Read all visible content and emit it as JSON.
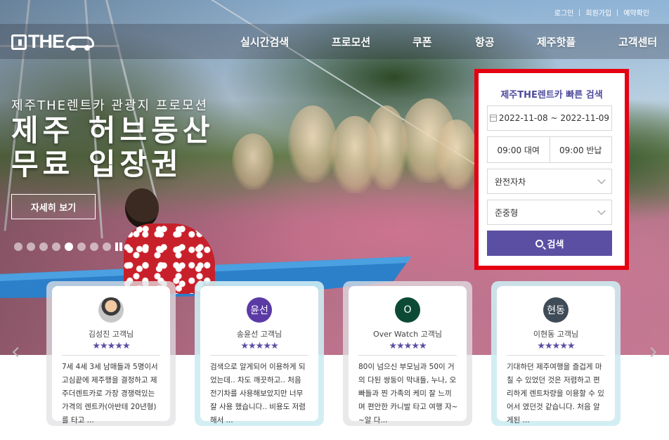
{
  "top_links": [
    "로그인",
    "회원가입",
    "예약확인"
  ],
  "logo": {
    "text": "THE"
  },
  "nav": [
    "실시간검색",
    "프로모션",
    "쿠폰",
    "항공",
    "제주핫플",
    "고객센터"
  ],
  "promo": {
    "subtitle": "제주THE렌트카 관광지 프로모션",
    "title": "제주 허브동산\n무료 입장권",
    "detail_label": "자세히 보기",
    "slide_count": 8,
    "active_slide": 5
  },
  "search": {
    "title": "제주THE렌트카 빠른 검색",
    "date_range": "2022-11-08 ~ 2022-11-09",
    "pickup": "09:00 대여",
    "return": "09:00 반납",
    "insurance": "완전자차",
    "car_class": "준중형",
    "button_label": "검색"
  },
  "colors": {
    "accent": "#5b4fa3",
    "highlight_border": "#e50012"
  },
  "reviews": [
    {
      "avatar": "",
      "avatar_color": "",
      "name": "김성진 고객님",
      "stars": "★★★★★",
      "text": "7세 4세 3세 남매들과 5명이서 고심끝에 제주행을 결정하고 제주더렌트카로 가장 경쟁력있는 가격의 렌트카(아반테 20년형)를 타고 ..."
    },
    {
      "avatar": "윤선",
      "avatar_color": "#5b3aa6",
      "name": "송윤선 고객님",
      "stars": "★★★★★",
      "text": "검색으로 알게되어 이용하게 되었는데.. 차도 깨끗하고.. 처음 전기차를 사용해보았지만 너무 잘 사용 했습니다.. 비용도 저렴해서 ..."
    },
    {
      "avatar": "O",
      "avatar_color": "#0d4a36",
      "name": "Over Watch 고객님",
      "stars": "★★★★★",
      "text": "80이 넘으신 부모님과 50이 거의 다된 쌍둥이 막내들, 누나, 오빠들과 찐 가족의 케미 잘 느끼며 편안한 카니발 타고 여행 자~~알 다..."
    },
    {
      "avatar": "현동",
      "avatar_color": "#3f4b56",
      "name": "이현동 고객님",
      "stars": "★★★★★",
      "text": "기대하던 제주여행을 즐겁게 마칠 수 있었던 것은 저렴하고 편리하게 렌트차량을 이용할 수 있어서 였던것 같습니다. 처음 알게된 ..."
    }
  ]
}
